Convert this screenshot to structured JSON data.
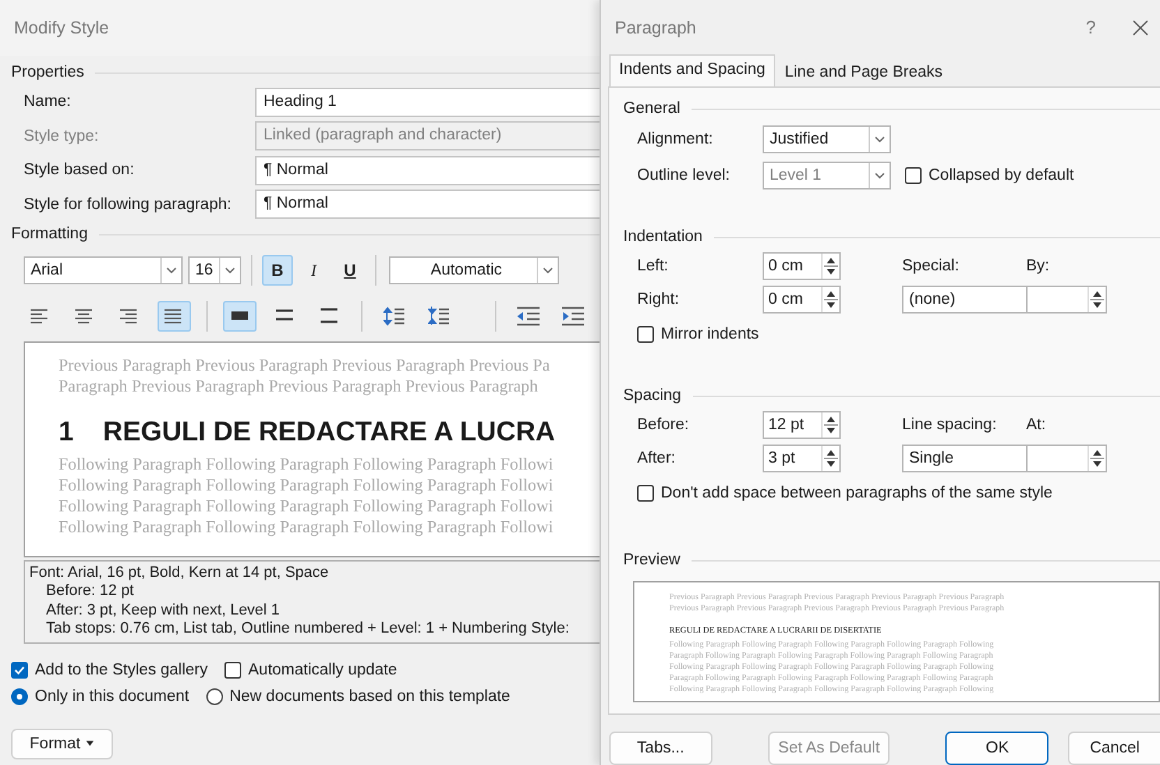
{
  "modify_style": {
    "title": "Modify Style",
    "properties": {
      "heading": "Properties",
      "fields": [
        {
          "label": "Name:",
          "value": "Heading 1",
          "disabled": false
        },
        {
          "label": "Style type:",
          "value": "Linked (paragraph and character)",
          "disabled": true
        },
        {
          "label": "Style based on:",
          "value": "¶ Normal",
          "disabled": false
        },
        {
          "label": "Style for following paragraph:",
          "value": "¶ Normal",
          "disabled": false
        }
      ]
    },
    "formatting": {
      "heading": "Formatting",
      "font": "Arial",
      "size": "16",
      "font_color_value": "Automatic",
      "styles": [
        {
          "kind": "bold",
          "label": "B",
          "selected": true
        },
        {
          "kind": "italic",
          "label": "I",
          "selected": false
        },
        {
          "kind": "underline",
          "label": "U",
          "selected": false
        }
      ],
      "paragraph_buttons": [
        {
          "kind": "align-left",
          "selected": false
        },
        {
          "kind": "align-center",
          "selected": false
        },
        {
          "kind": "align-right",
          "selected": false
        },
        {
          "kind": "justify",
          "selected": true
        },
        {
          "kind": "single",
          "selected": true
        },
        {
          "kind": "one-half",
          "selected": false
        },
        {
          "kind": "double",
          "selected": false
        },
        {
          "kind": "space-increase",
          "selected": false
        },
        {
          "kind": "space-decrease",
          "selected": false
        },
        {
          "kind": "indent-decrease",
          "selected": false
        },
        {
          "kind": "indent-increase",
          "selected": false
        }
      ]
    },
    "preview": {
      "previous": [
        "Previous Paragraph Previous Paragraph Previous Paragraph Previous Pa",
        "Paragraph Previous Paragraph Previous Paragraph Previous Paragraph"
      ],
      "number": "1",
      "heading": "REGULI DE REDACTARE A LUCRA",
      "following": [
        "Following Paragraph Following Paragraph Following Paragraph Followi",
        "Following Paragraph Following Paragraph Following Paragraph Followi",
        "Following Paragraph Following Paragraph Following Paragraph Followi",
        "Following Paragraph Following Paragraph Following Paragraph Followi"
      ]
    },
    "description": [
      {
        "text": "Font: Arial, 16 pt, Bold, Kern at 14 pt, Space",
        "indented": false
      },
      {
        "text": "Before:  12 pt",
        "indented": true
      },
      {
        "text": "After:  3 pt, Keep with next, Level 1",
        "indented": true
      },
      {
        "text": "Tab stops:  0.76 cm, List tab, Outline numbered + Level: 1 + Numbering Style:",
        "indented": true
      }
    ],
    "options": [
      {
        "label": "Add to the Styles gallery",
        "checked": true
      },
      {
        "label": "Automatically update",
        "checked": false
      }
    ],
    "scope": [
      {
        "label": "Only in this document",
        "selected": true
      },
      {
        "label": "New documents based on this template",
        "selected": false
      }
    ],
    "format_button": "Format"
  },
  "paragraph": {
    "title": "Paragraph",
    "help": "?",
    "tabs": [
      {
        "label": "Indents and Spacing",
        "selected": true
      },
      {
        "label": "Line and Page Breaks",
        "selected": false
      }
    ],
    "general": {
      "heading": "General",
      "alignment": {
        "label": "Alignment:",
        "value": "Justified",
        "disabled": false
      },
      "outline_level": {
        "label": "Outline level:",
        "value": "Level 1",
        "disabled": true
      },
      "collapsed": {
        "label": "Collapsed by default",
        "checked": false
      }
    },
    "indentation": {
      "heading": "Indentation",
      "left": {
        "label": "Left:",
        "value": "0 cm"
      },
      "right": {
        "label": "Right:",
        "value": "0 cm"
      },
      "special": {
        "label": "Special:",
        "value": "(none)"
      },
      "by": {
        "label": "By:"
      },
      "mirror": {
        "label": "Mirror indents",
        "checked": false
      }
    },
    "spacing": {
      "heading": "Spacing",
      "before": {
        "label": "Before:",
        "value": "12 pt"
      },
      "after": {
        "label": "After:",
        "value": "3 pt"
      },
      "line_spacing": {
        "label": "Line spacing:",
        "value": "Single"
      },
      "at": {
        "label": "At:"
      },
      "dont_add": {
        "label": "Don't add space between paragraphs of the same style",
        "checked": false
      }
    },
    "preview": {
      "heading": "Preview",
      "previous": [
        "Previous Paragraph Previous Paragraph Previous Paragraph Previous Paragraph Previous Paragraph",
        "Previous Paragraph Previous Paragraph Previous Paragraph Previous Paragraph Previous Paragraph"
      ],
      "title": "REGULI DE REDACTARE A LUCRARII DE DISERTATIE",
      "following": [
        "Following Paragraph Following Paragraph Following Paragraph Following Paragraph Following",
        "Paragraph Following Paragraph Following Paragraph Following Paragraph Following Paragraph",
        "Following Paragraph Following Paragraph Following Paragraph Following Paragraph Following",
        "Paragraph Following Paragraph Following Paragraph Following Paragraph Following Paragraph",
        "Following Paragraph Following Paragraph Following Paragraph Following Paragraph Following"
      ]
    },
    "buttons": [
      {
        "label": "Tabs...",
        "disabled": false,
        "default": false
      },
      {
        "label": "Set As Default",
        "disabled": true,
        "default": false
      },
      {
        "label": "OK",
        "disabled": false,
        "default": true
      },
      {
        "label": "Cancel",
        "disabled": false,
        "default": false
      }
    ]
  }
}
